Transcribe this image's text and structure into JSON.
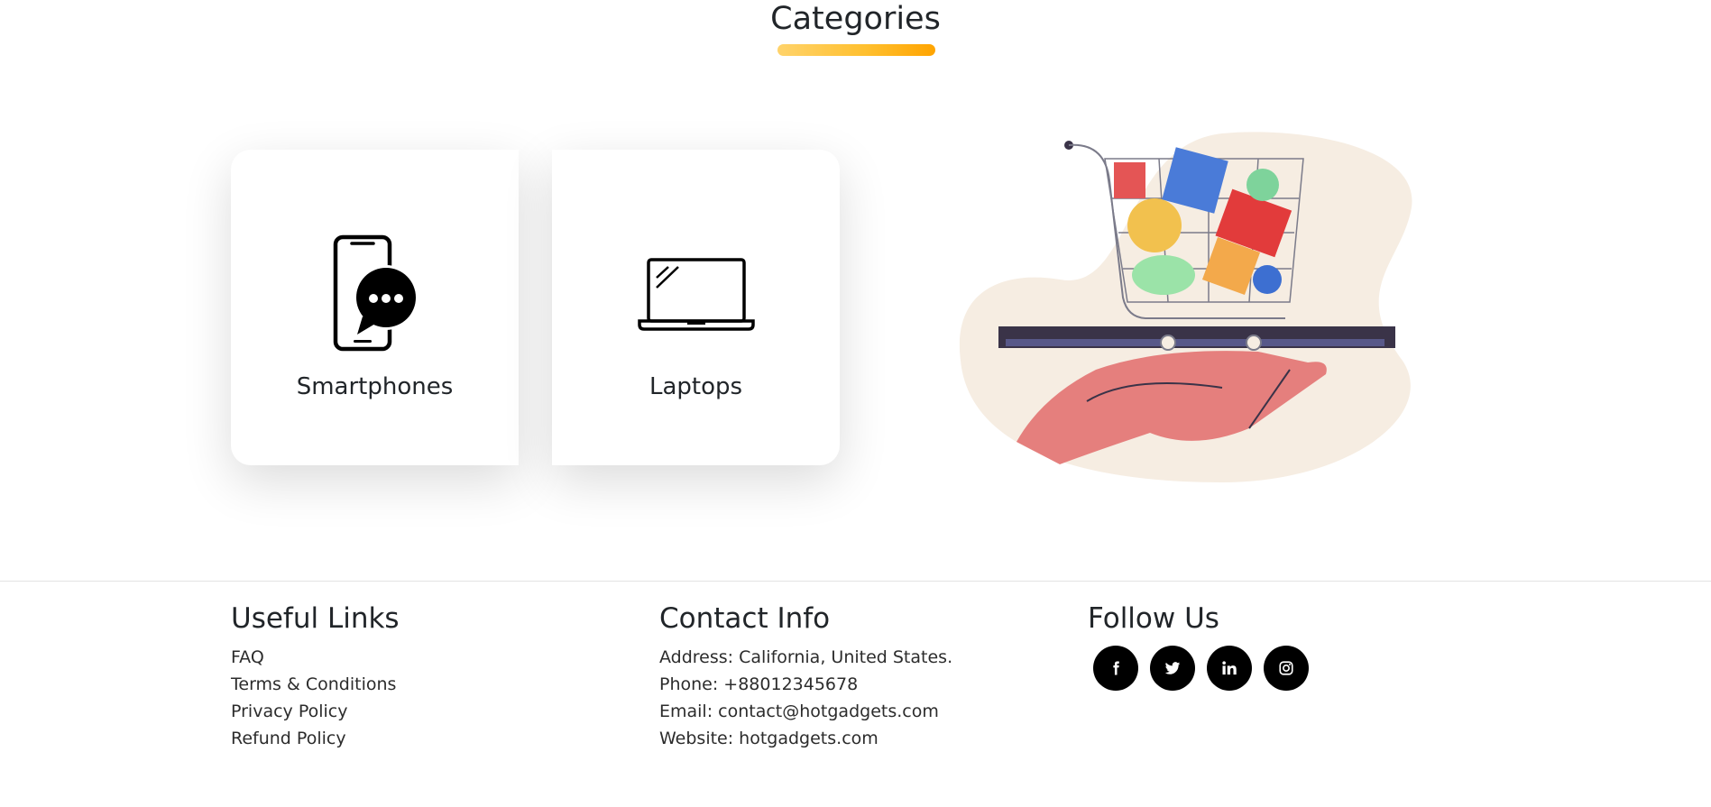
{
  "categories": {
    "title": "Categories",
    "items": [
      {
        "label": "Smartphones",
        "icon": "smartphone-chat-icon"
      },
      {
        "label": "Laptops",
        "icon": "laptop-icon"
      }
    ],
    "illustration": "shopping-cart-on-hand-illustration"
  },
  "footer": {
    "useful_links": {
      "heading": "Useful Links",
      "links": [
        "FAQ",
        "Terms & Conditions",
        "Privacy Policy",
        "Refund Policy"
      ]
    },
    "contact": {
      "heading": "Contact Info",
      "address": "Address: California, United States.",
      "phone": "Phone: +88012345678",
      "email": "Email: contact@hotgadgets.com",
      "website": "Website: hotgadgets.com"
    },
    "follow": {
      "heading": "Follow Us",
      "icons": [
        "facebook-icon",
        "twitter-icon",
        "linkedin-icon",
        "instagram-icon"
      ]
    }
  },
  "colors": {
    "accent_start": "#ffd36b",
    "accent_end": "#ffa400",
    "social_bg": "#000000"
  }
}
